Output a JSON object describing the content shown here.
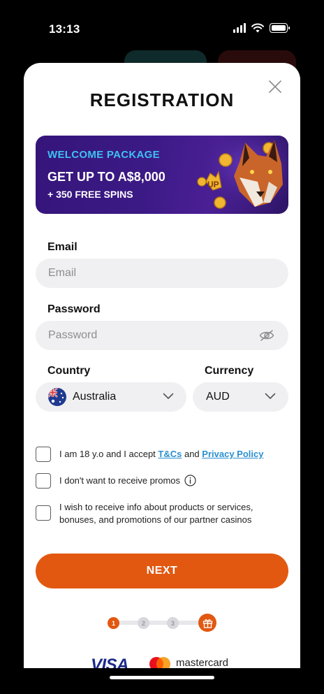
{
  "status_bar": {
    "time": "13:13",
    "icons": [
      "signal-icon",
      "wifi-icon",
      "battery-icon"
    ]
  },
  "modal": {
    "title": "REGISTRATION",
    "close_icon": "close-icon"
  },
  "banner": {
    "eyebrow": "WELCOME PACKAGE",
    "headline": "GET UP TO A$8,000",
    "sub": "+ 350 FREE SPINS",
    "art": "wolf-coins-illustration",
    "eyebrow_color": "#3dc1f0"
  },
  "form": {
    "email": {
      "label": "Email",
      "placeholder": "Email",
      "value": ""
    },
    "password": {
      "label": "Password",
      "placeholder": "Password",
      "value": "",
      "toggle_icon": "eye-off-icon"
    },
    "country": {
      "label": "Country",
      "value": "Australia",
      "flag": "australia-flag-icon"
    },
    "currency": {
      "label": "Currency",
      "value": "AUD"
    }
  },
  "consents": {
    "age": {
      "prefix": "I am 18 y.o and I accept ",
      "tcs": "T&Cs",
      "and": " and ",
      "privacy": "Privacy Policy",
      "checked": false
    },
    "promos": {
      "text": "I don't want to receive promos",
      "info_icon": "info-icon",
      "checked": false
    },
    "partners": {
      "text": "I wish to receive info about products or services, bonuses, and promotions of our partner casinos",
      "checked": false
    }
  },
  "actions": {
    "next_label": "NEXT",
    "accent": "#e25811"
  },
  "stepper": {
    "steps": [
      "1",
      "2",
      "3"
    ],
    "current": 1,
    "final_icon": "gift-icon"
  },
  "payments": {
    "visa": "VISA",
    "mastercard": "mastercard"
  }
}
